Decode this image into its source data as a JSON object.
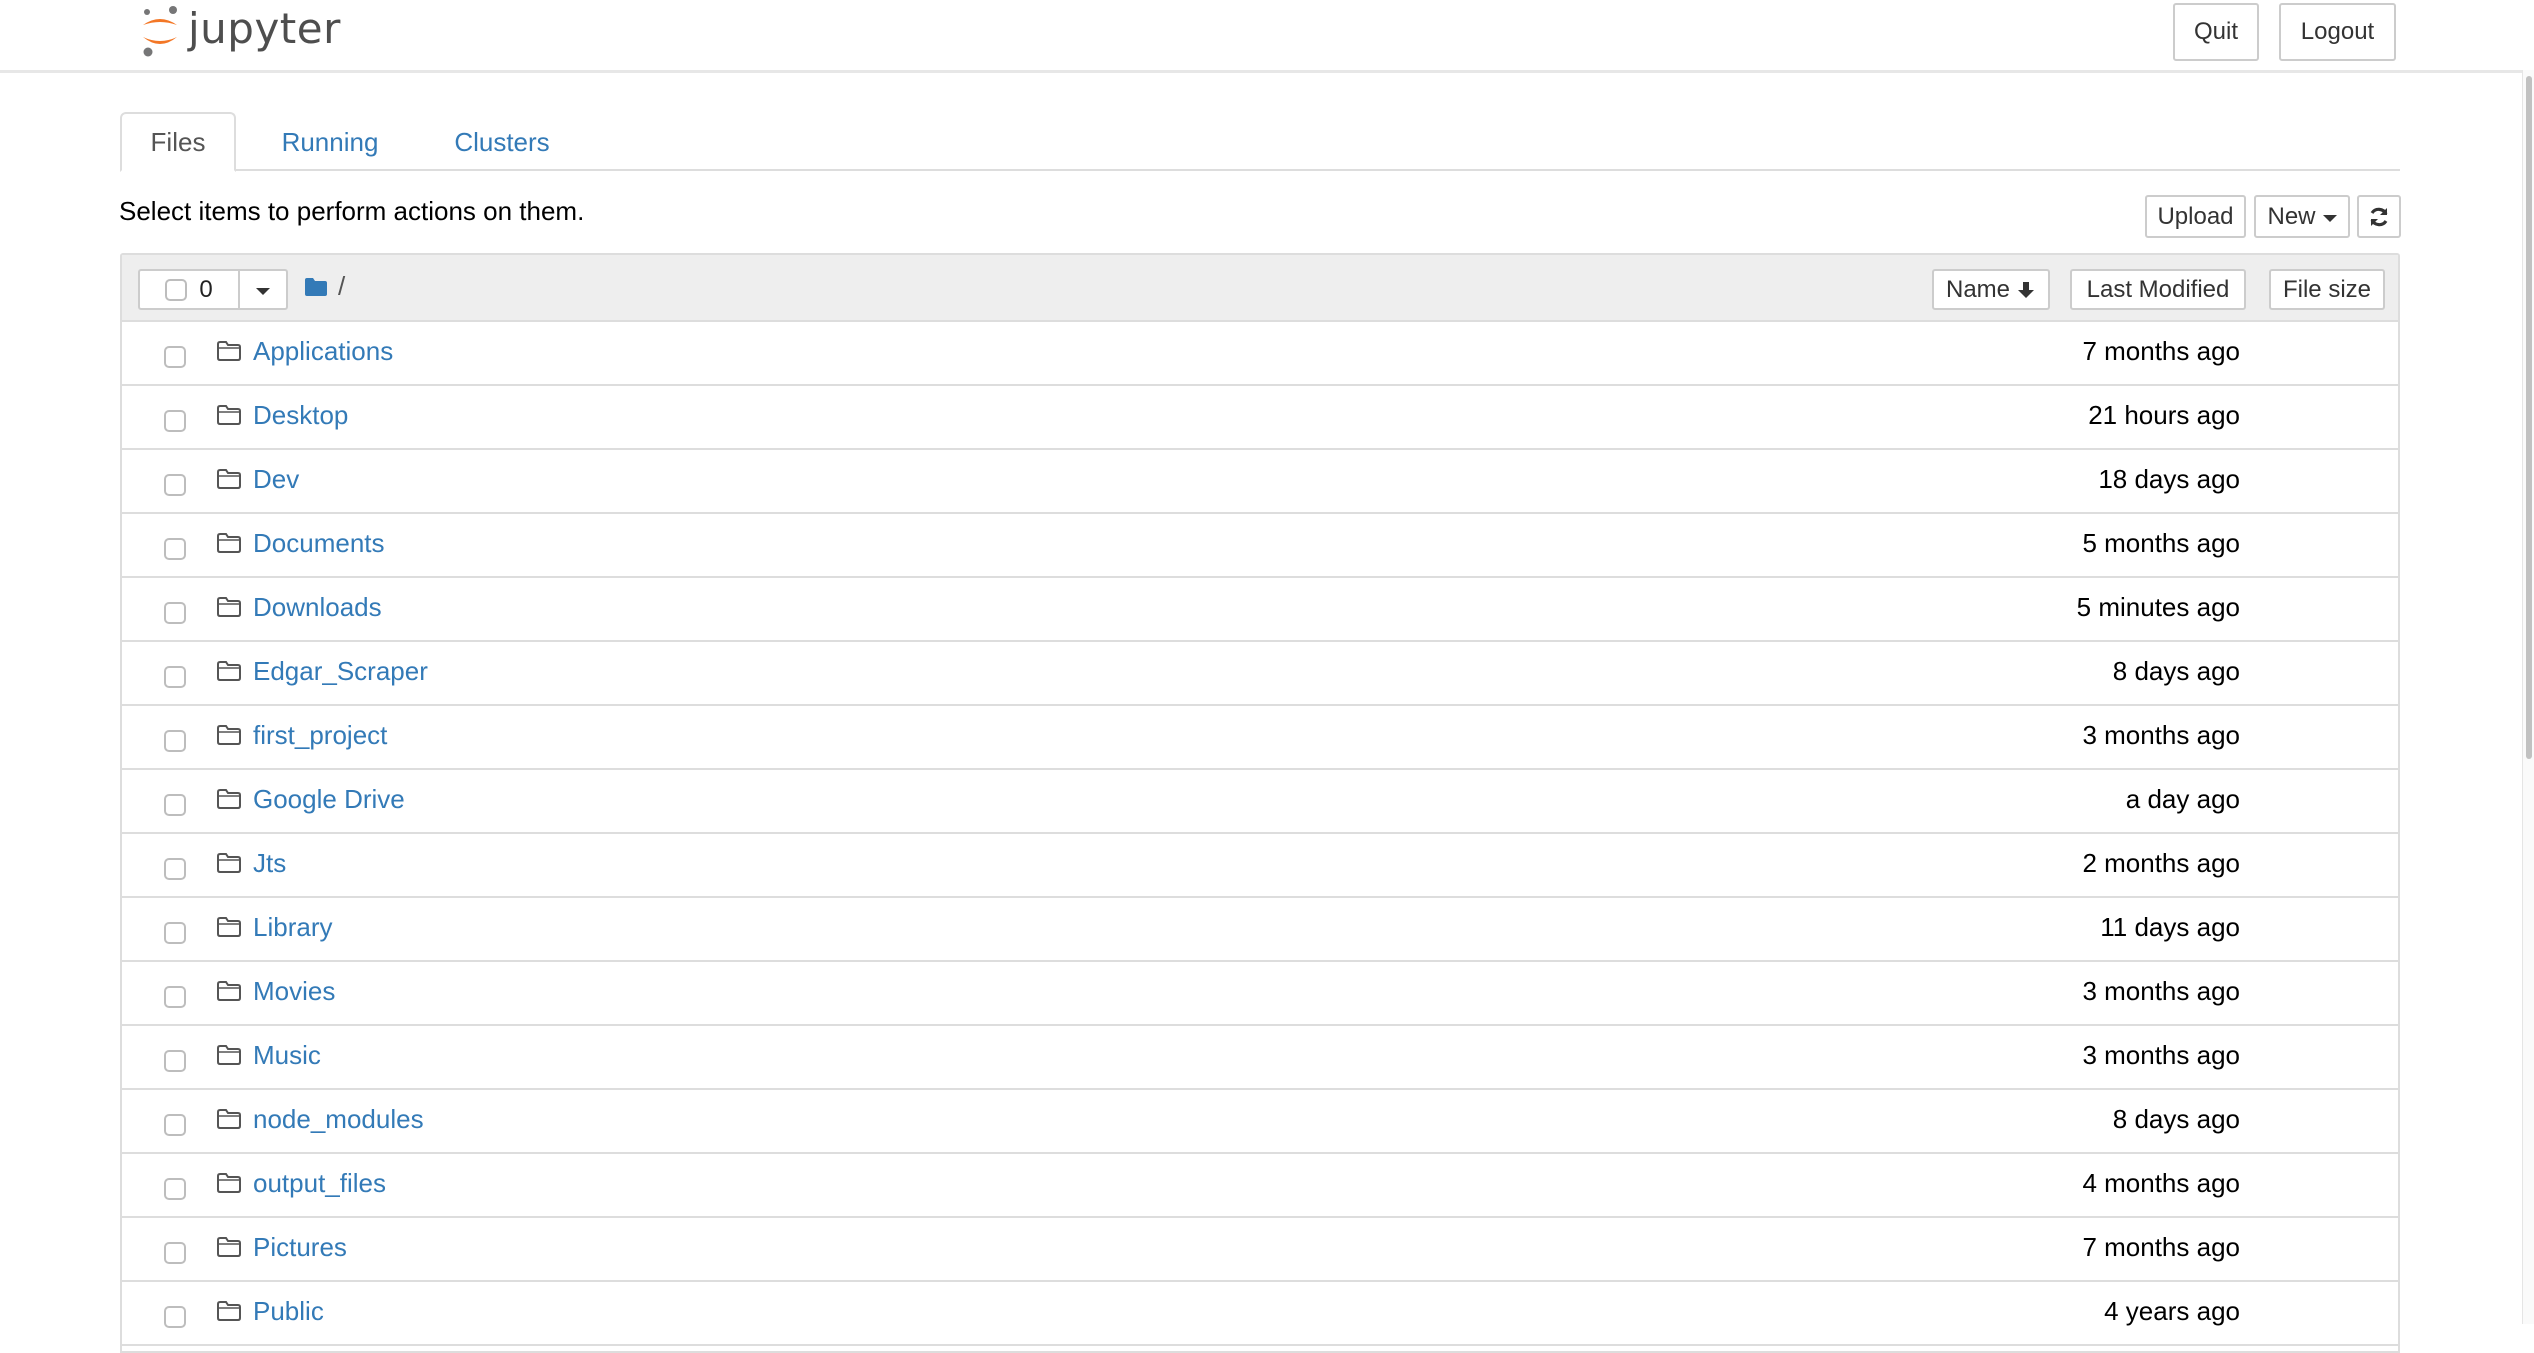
{
  "header": {
    "logo_text": "jupyter",
    "quit_label": "Quit",
    "logout_label": "Logout"
  },
  "tabs": [
    {
      "label": "Files",
      "active": true
    },
    {
      "label": "Running",
      "active": false
    },
    {
      "label": "Clusters",
      "active": false
    }
  ],
  "toolbar": {
    "hint": "Select items to perform actions on them.",
    "upload_label": "Upload",
    "new_label": "New",
    "refresh_icon": "refresh-icon"
  },
  "list_header": {
    "selected_count": "0",
    "breadcrumb_icon": "folder-solid-icon",
    "breadcrumb_path": "/",
    "sort_name_label": "Name",
    "sort_name_icon": "arrow-down-icon",
    "sort_modified_label": "Last Modified",
    "sort_size_label": "File size"
  },
  "files": [
    {
      "name": "Applications",
      "modified": "7 months ago",
      "type": "folder"
    },
    {
      "name": "Desktop",
      "modified": "21 hours ago",
      "type": "folder"
    },
    {
      "name": "Dev",
      "modified": "18 days ago",
      "type": "folder"
    },
    {
      "name": "Documents",
      "modified": "5 months ago",
      "type": "folder"
    },
    {
      "name": "Downloads",
      "modified": "5 minutes ago",
      "type": "folder"
    },
    {
      "name": "Edgar_Scraper",
      "modified": "8 days ago",
      "type": "folder"
    },
    {
      "name": "first_project",
      "modified": "3 months ago",
      "type": "folder"
    },
    {
      "name": "Google Drive",
      "modified": "a day ago",
      "type": "folder"
    },
    {
      "name": "Jts",
      "modified": "2 months ago",
      "type": "folder"
    },
    {
      "name": "Library",
      "modified": "11 days ago",
      "type": "folder"
    },
    {
      "name": "Movies",
      "modified": "3 months ago",
      "type": "folder"
    },
    {
      "name": "Music",
      "modified": "3 months ago",
      "type": "folder"
    },
    {
      "name": "node_modules",
      "modified": "8 days ago",
      "type": "folder"
    },
    {
      "name": "output_files",
      "modified": "4 months ago",
      "type": "folder"
    },
    {
      "name": "Pictures",
      "modified": "7 months ago",
      "type": "folder"
    },
    {
      "name": "Public",
      "modified": "4 years ago",
      "type": "folder"
    }
  ],
  "colors": {
    "link": "#337ab7",
    "logo_orange": "#f37726",
    "logo_gray": "#767677",
    "border": "#dddddd",
    "header_bg": "#eeeeee"
  },
  "scrollbar": {
    "thumb_fraction": 0.55,
    "scroll_position": 0
  }
}
